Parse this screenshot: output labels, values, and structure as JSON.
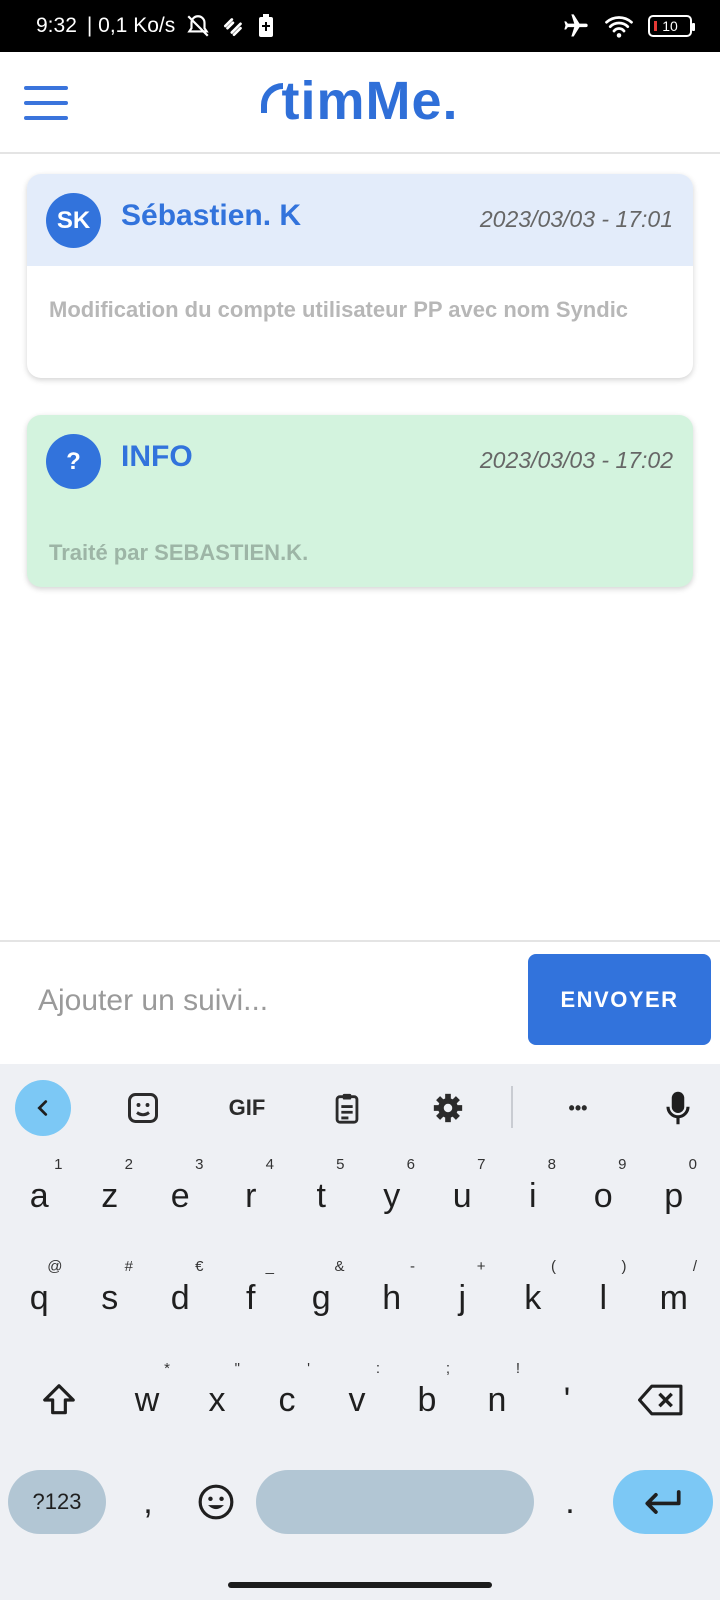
{
  "status_bar": {
    "time": "9:32",
    "network_speed": "| 0,1 Ko/s",
    "battery_level": "10",
    "icons": [
      "alarm-off-icon",
      "link-icon",
      "battery-saver-icon",
      "airplane-icon",
      "wifi-icon",
      "battery-icon"
    ]
  },
  "app_bar": {
    "logo_text": "timMe."
  },
  "messages": [
    {
      "avatar_initials": "SK",
      "author": "Sébastien. K",
      "timestamp": "2023/03/03 - 17:01",
      "body": "Modification du compte utilisateur PP avec nom Syndic"
    },
    {
      "avatar_initials": "?",
      "author": "INFO",
      "timestamp": "2023/03/03 - 17:02",
      "body": "Traité par SEBASTIEN.K."
    }
  ],
  "composer": {
    "placeholder": "Ajouter un suivi...",
    "send_label": "ENVOYER"
  },
  "keyboard": {
    "toolbar": {
      "gif_label": "GIF",
      "more_label": "•••"
    },
    "row1": [
      {
        "k": "a",
        "s": "1"
      },
      {
        "k": "z",
        "s": "2"
      },
      {
        "k": "e",
        "s": "3"
      },
      {
        "k": "r",
        "s": "4"
      },
      {
        "k": "t",
        "s": "5"
      },
      {
        "k": "y",
        "s": "6"
      },
      {
        "k": "u",
        "s": "7"
      },
      {
        "k": "i",
        "s": "8"
      },
      {
        "k": "o",
        "s": "9"
      },
      {
        "k": "p",
        "s": "0"
      }
    ],
    "row2": [
      {
        "k": "q",
        "s": "@"
      },
      {
        "k": "s",
        "s": "#"
      },
      {
        "k": "d",
        "s": "€"
      },
      {
        "k": "f",
        "s": "_"
      },
      {
        "k": "g",
        "s": "&"
      },
      {
        "k": "h",
        "s": "-"
      },
      {
        "k": "j",
        "s": "+"
      },
      {
        "k": "k",
        "s": "("
      },
      {
        "k": "l",
        "s": ")"
      },
      {
        "k": "m",
        "s": "/"
      }
    ],
    "row3": [
      {
        "k": "w",
        "s": "*"
      },
      {
        "k": "x",
        "s": "\""
      },
      {
        "k": "c",
        "s": "'"
      },
      {
        "k": "v",
        "s": ":"
      },
      {
        "k": "b",
        "s": ";"
      },
      {
        "k": "n",
        "s": "!"
      },
      {
        "k": "'",
        "s": ""
      }
    ],
    "symbols_label": "?123",
    "comma_label": ",",
    "period_label": "."
  }
}
